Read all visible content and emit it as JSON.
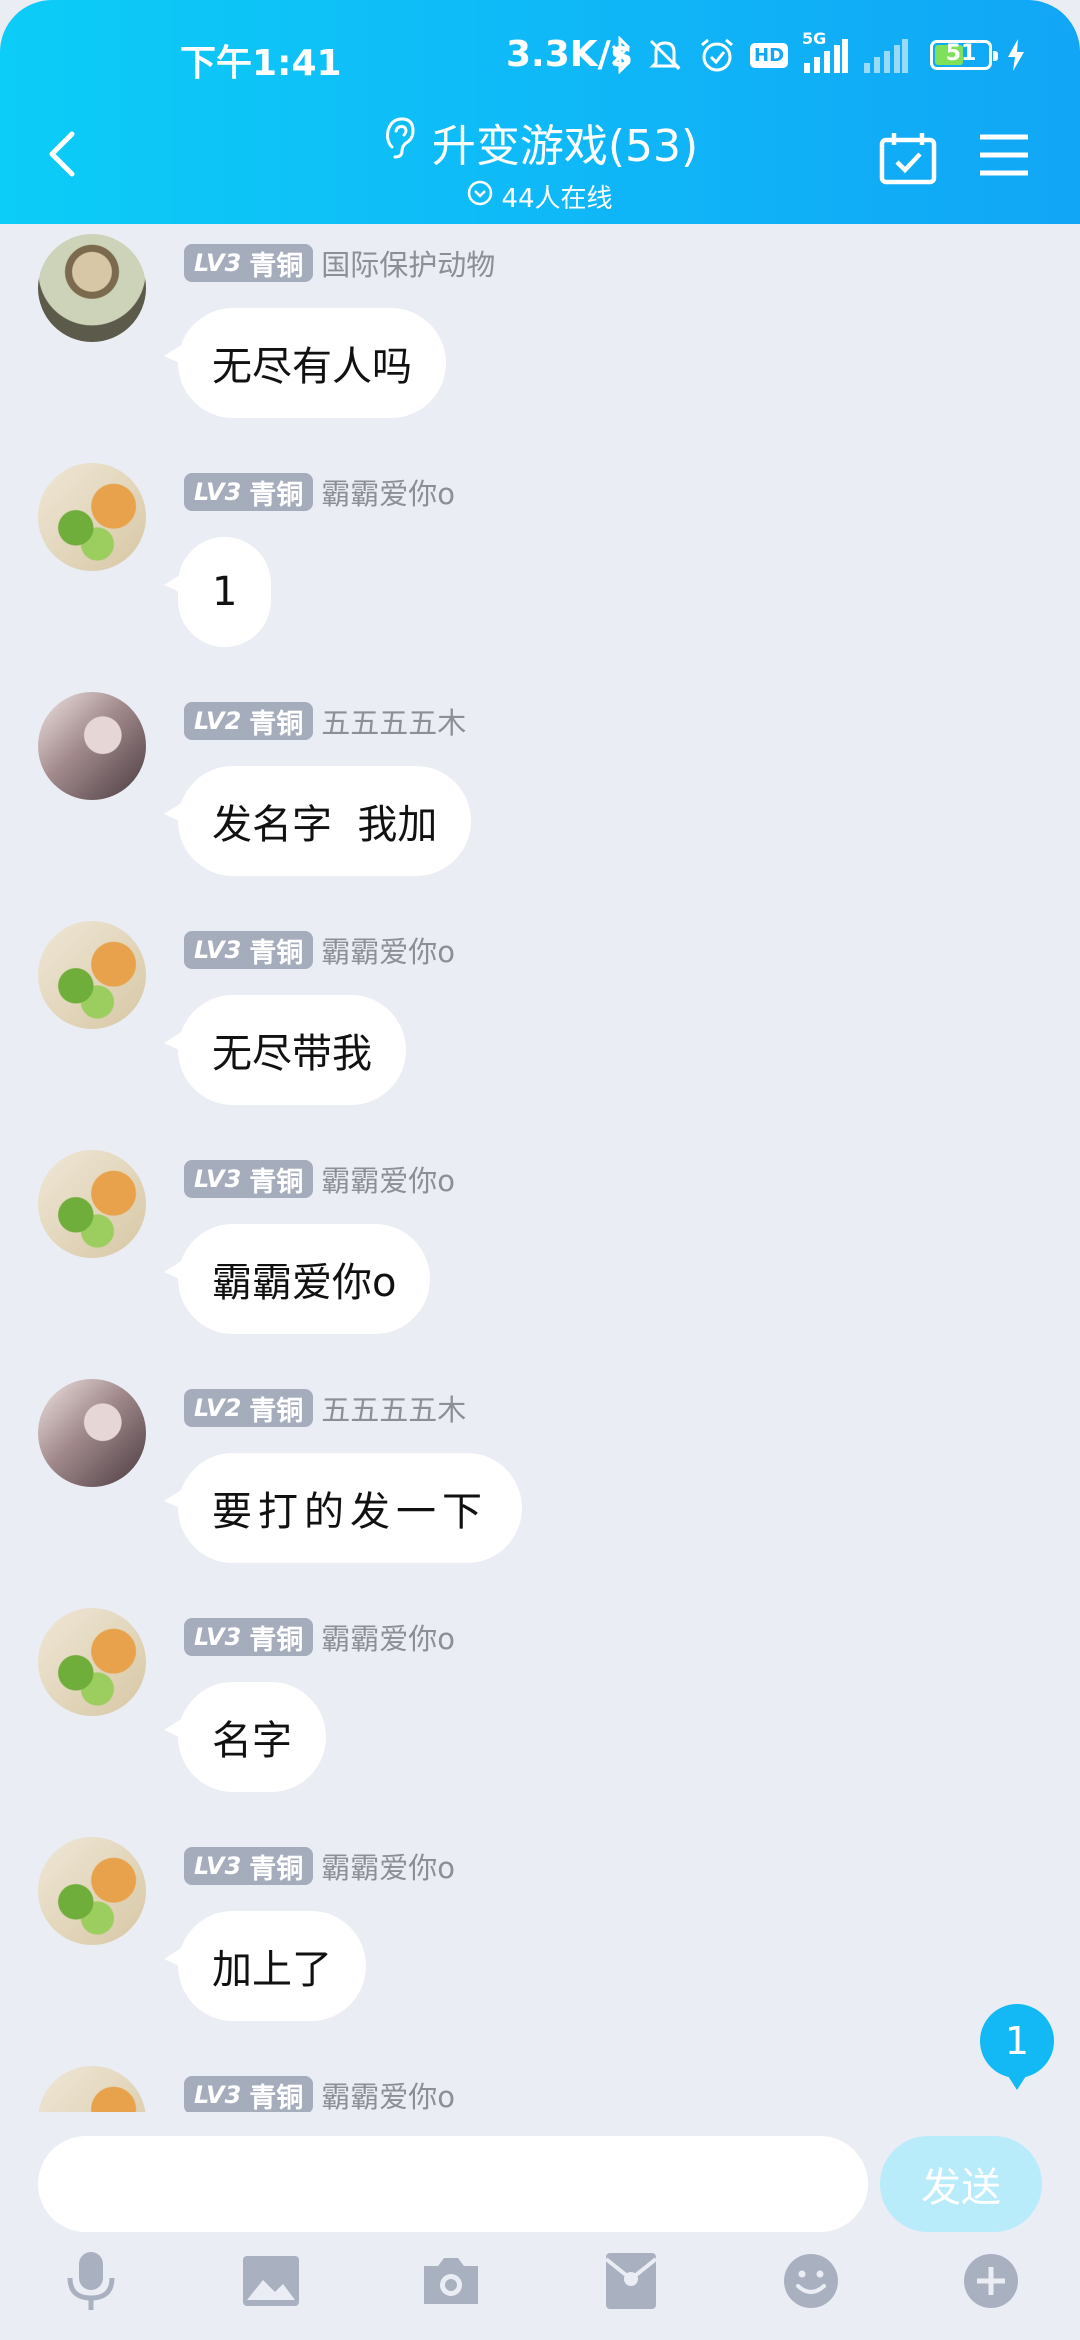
{
  "status_bar": {
    "time": "下午1:41",
    "net_speed": "3.3K/s",
    "battery_level": "51",
    "signal_label": "5G",
    "hd_label": "HD"
  },
  "header": {
    "title": "升变游戏(53)",
    "online_count": "44人在线",
    "accent_color": "#0fb7f7"
  },
  "messages": [
    {
      "level": "LV3",
      "rank": "青铜",
      "nickname": "国际保护动物",
      "text": "无尽有人吗",
      "avatar": "man-avatar"
    },
    {
      "level": "LV3",
      "rank": "青铜",
      "nickname": "霸霸爱你o",
      "text": "1",
      "avatar": "food-avatar"
    },
    {
      "level": "LV2",
      "rank": "青铜",
      "nickname": "五五五五木",
      "text": "发名字  我加",
      "avatar": "art-avatar"
    },
    {
      "level": "LV3",
      "rank": "青铜",
      "nickname": "霸霸爱你o",
      "text": "无尽带我",
      "avatar": "food-avatar"
    },
    {
      "level": "LV3",
      "rank": "青铜",
      "nickname": "霸霸爱你o",
      "text": "霸霸爱你o",
      "avatar": "food-avatar"
    },
    {
      "level": "LV2",
      "rank": "青铜",
      "nickname": "五五五五木",
      "text": "要打的发一下",
      "avatar": "art-avatar"
    },
    {
      "level": "LV3",
      "rank": "青铜",
      "nickname": "霸霸爱你o",
      "text": "名字",
      "avatar": "food-avatar"
    },
    {
      "level": "LV3",
      "rank": "青铜",
      "nickname": "霸霸爱你o",
      "text": "加上了",
      "avatar": "food-avatar"
    },
    {
      "level": "LV3",
      "rank": "青铜",
      "nickname": "霸霸爱你o",
      "text": "",
      "avatar": "food-avatar"
    }
  ],
  "unread_badge": "1",
  "composer": {
    "placeholder": "",
    "send_label": "发送"
  },
  "toolbar_icons": [
    "microphone-icon",
    "image-icon",
    "camera-icon",
    "red-packet-icon",
    "emoji-icon",
    "plus-icon"
  ]
}
